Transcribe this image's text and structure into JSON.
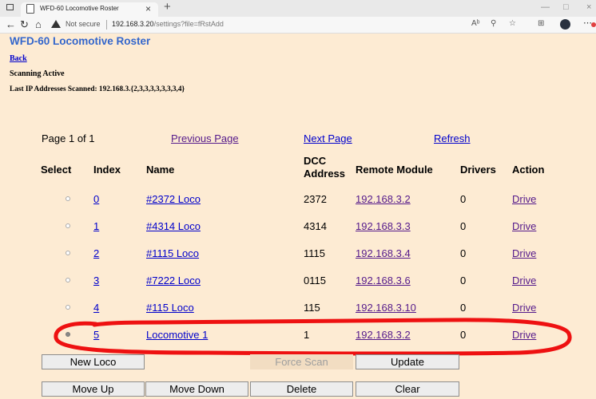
{
  "browser": {
    "tab_title": "WFD-60 Locomotive Roster",
    "tab_close": "×",
    "new_tab": "+",
    "not_secure": "Not secure",
    "url_host": "192.168.3.20",
    "url_path": "/settings?file=fRstAdd"
  },
  "page": {
    "heading": "WFD-60 Locomotive Roster",
    "back_link": "Back",
    "scanning_status": "Scanning Active",
    "last_ip": "Last IP Addresses Scanned: 192.168.3.{2,3,3,3,3,3,3,3,4}"
  },
  "pagination": {
    "page_info": "Page 1 of 1",
    "previous": "Previous Page",
    "next": "Next Page",
    "refresh": "Refresh"
  },
  "table": {
    "headers": {
      "select": "Select",
      "index": "Index",
      "name": "Name",
      "dcc_line1": "DCC",
      "dcc_line2": "Address",
      "remote": "Remote Module",
      "drivers": "Drivers",
      "action": "Action"
    },
    "rows": [
      {
        "index": "0",
        "name": "#2372 Loco",
        "dcc": "2372",
        "remote": "192.168.3.2",
        "drivers": "0",
        "action": "Drive",
        "selected": false
      },
      {
        "index": "1",
        "name": "#4314 Loco",
        "dcc": "4314",
        "remote": "192.168.3.3",
        "drivers": "0",
        "action": "Drive",
        "selected": false
      },
      {
        "index": "2",
        "name": "#1115 Loco",
        "dcc": "1115",
        "remote": "192.168.3.4",
        "drivers": "0",
        "action": "Drive",
        "selected": false
      },
      {
        "index": "3",
        "name": "#7222 Loco",
        "dcc": "0115",
        "remote": "192.168.3.6",
        "drivers": "0",
        "action": "Drive",
        "selected": false
      },
      {
        "index": "4",
        "name": "#115 Loco",
        "dcc": "115",
        "remote": "192.168.3.10",
        "drivers": "0",
        "action": "Drive",
        "selected": false
      },
      {
        "index": "5",
        "name": "Locomotive 1",
        "dcc": "1",
        "remote": "192.168.3.2",
        "drivers": "0",
        "action": "Drive",
        "selected": true
      }
    ]
  },
  "buttons": {
    "new_loco": "New Loco",
    "force_scan": "Force Scan",
    "update": "Update",
    "move_up": "Move Up",
    "move_down": "Move Down",
    "delete": "Delete",
    "clear": "Clear"
  },
  "annotation": {
    "color": "#ee1111"
  }
}
